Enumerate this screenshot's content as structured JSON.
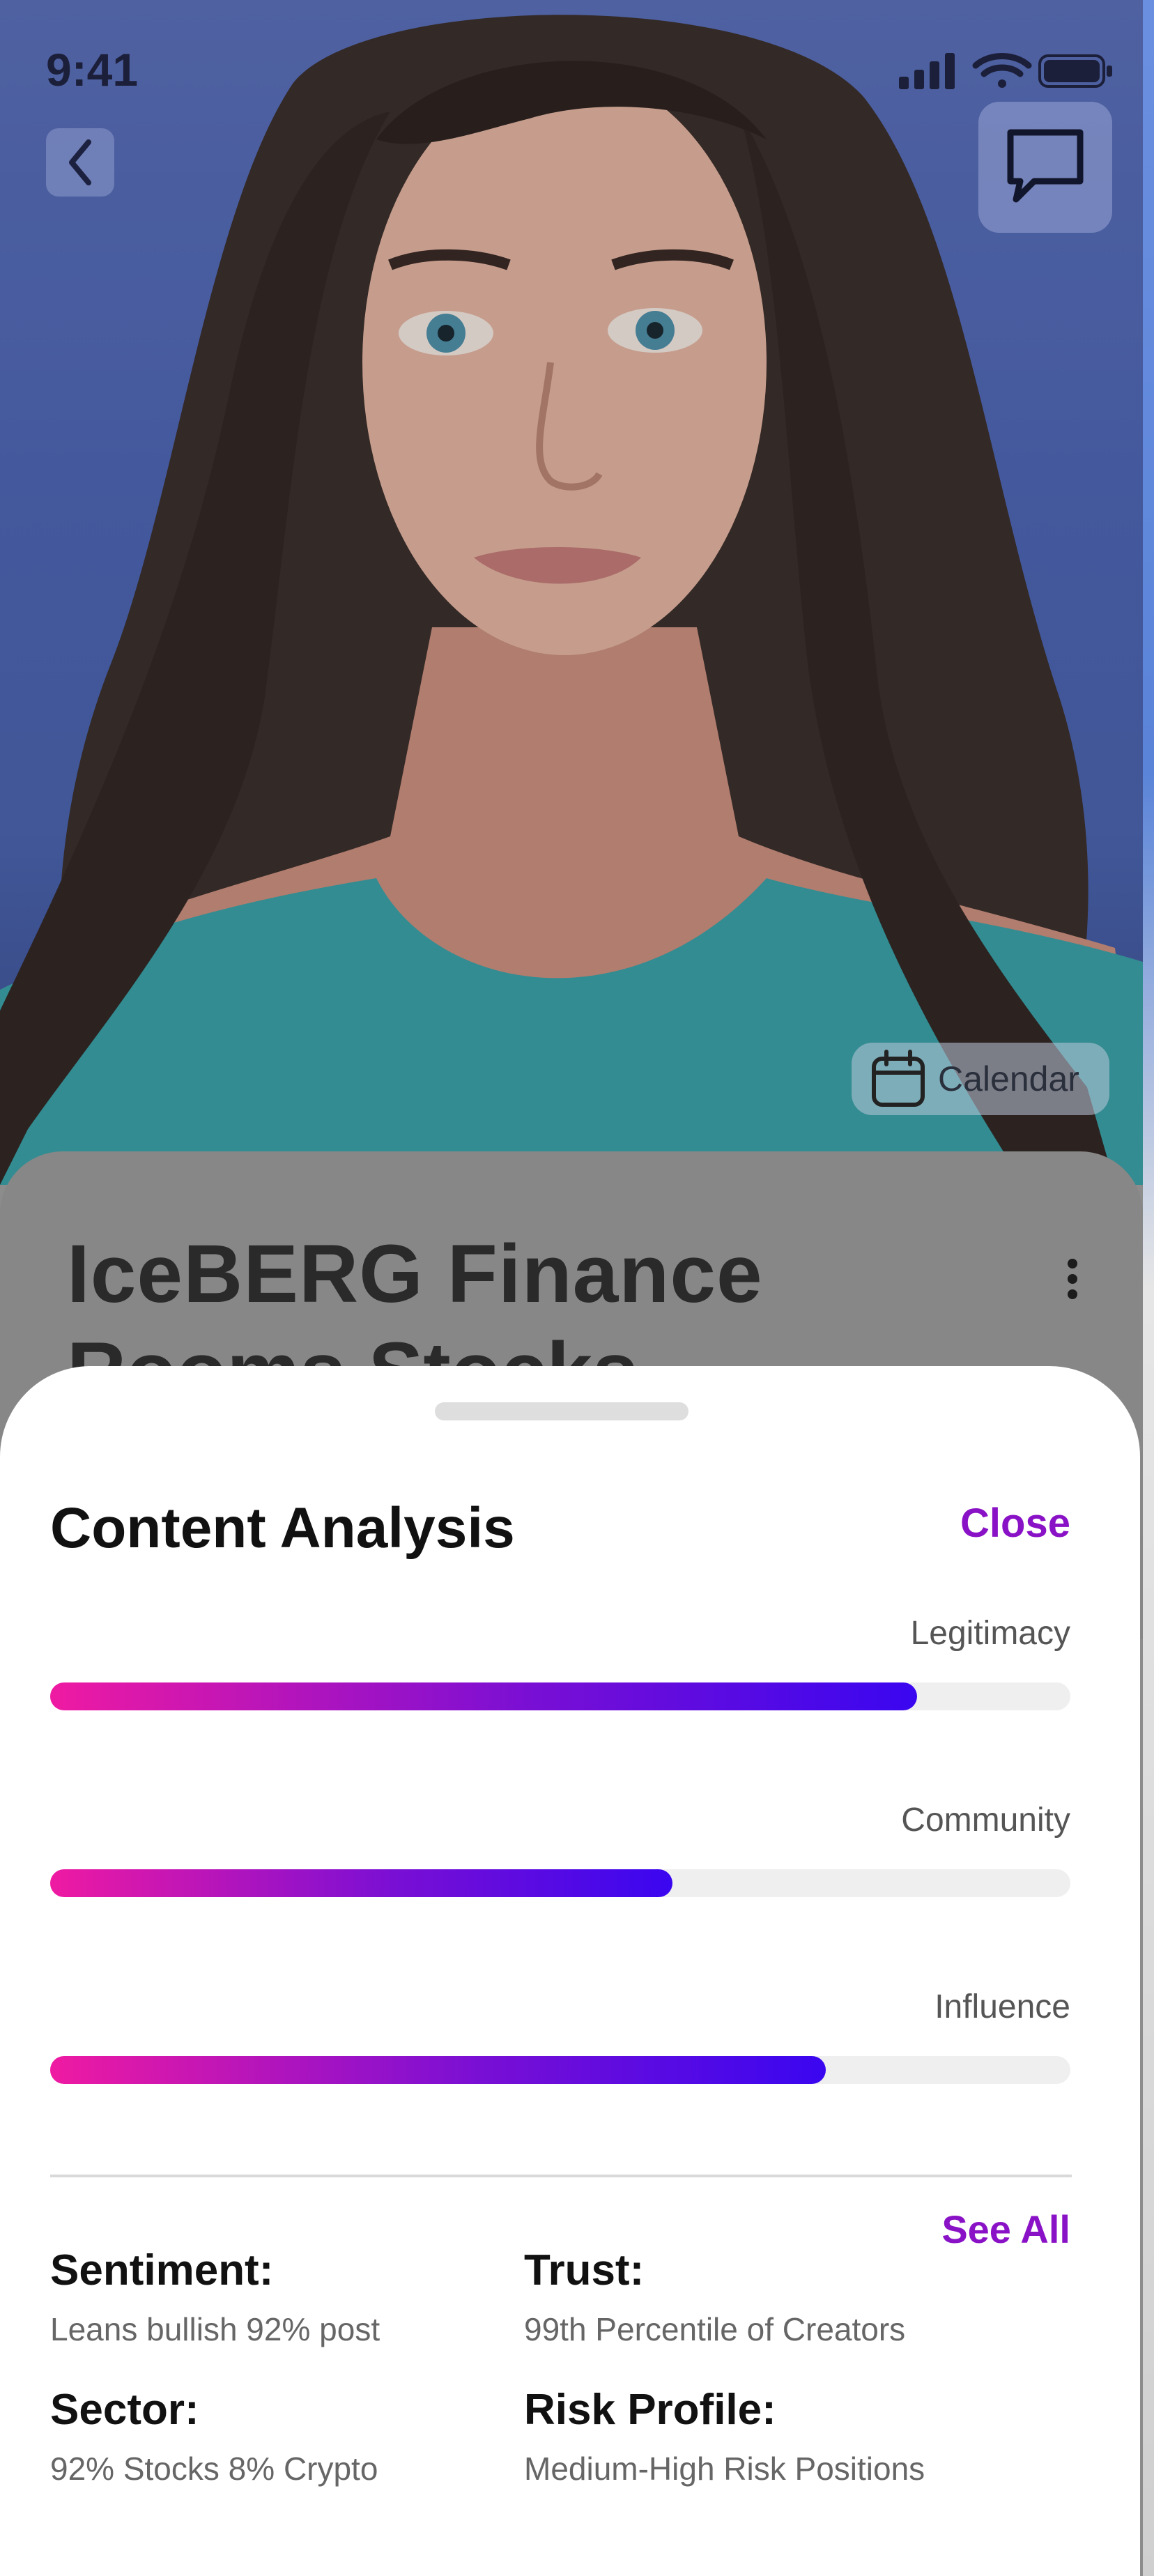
{
  "status_bar": {
    "time": "9:41"
  },
  "hero": {
    "back_icon": "chevron-left-icon",
    "chat_icon": "chat-bubble-icon",
    "calendar_label": "Calendar",
    "calendar_icon": "calendar-icon"
  },
  "card": {
    "title": "IceBERG Finance",
    "subtitle_partial": "Rooms Stocks",
    "menu_icon": "kebab-menu-icon"
  },
  "sheet": {
    "title": "Content Analysis",
    "close_label": "Close",
    "metrics": [
      {
        "label": "Legitimacy",
        "value": 0.85
      },
      {
        "label": "Community",
        "value": 0.61
      },
      {
        "label": "Influence",
        "value": 0.76
      }
    ],
    "see_all_label": "See All",
    "details": [
      {
        "heading": "Sentiment:",
        "value": "Leans bullish 92% post"
      },
      {
        "heading": "Trust:",
        "value": "99th Percentile of Creators"
      },
      {
        "heading": "Sector:",
        "value": "92% Stocks 8% Crypto"
      },
      {
        "heading": "Risk Profile:",
        "value": "Medium-High Risk Positions"
      }
    ],
    "colors": {
      "accent": "#8a12c6",
      "gradient_start": "#ef1aa2",
      "gradient_end": "#3a06f0"
    }
  }
}
